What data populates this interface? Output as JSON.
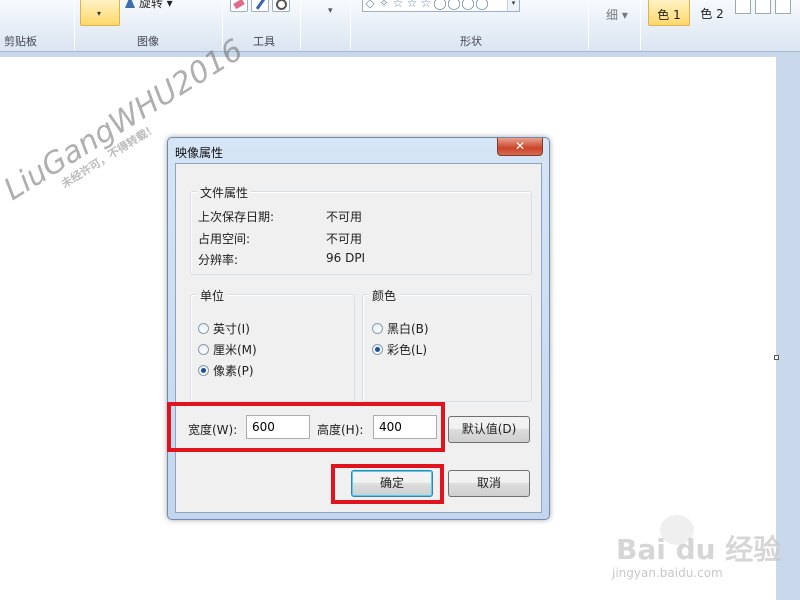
{
  "ribbon": {
    "groups": {
      "clipboard": "剪贴板",
      "image": "图像",
      "tools": "工具",
      "shapes": "形状"
    },
    "rotate_label": "旋转",
    "thin_label": "细",
    "color1": "色 1",
    "color2": "色 2",
    "shape_glyphs": [
      "◇",
      "✧",
      "☆",
      "☆",
      "☆",
      "◯",
      "◯",
      "◯",
      "◯"
    ]
  },
  "watermark": {
    "main": "LiuGangWHU2016",
    "sub": "未经许可，不得转载！"
  },
  "baidu": {
    "logo": "Bai du 经验",
    "url": "jingyan.baidu.com"
  },
  "dialog": {
    "title": "映像属性",
    "close_glyph": "✕",
    "file_props": {
      "title": "文件属性",
      "rows": [
        {
          "label": "上次保存日期:",
          "value": "不可用"
        },
        {
          "label": "占用空间:",
          "value": "不可用"
        },
        {
          "label": "分辨率:",
          "value": "96 DPI"
        }
      ]
    },
    "units": {
      "title": "单位",
      "options": [
        {
          "label": "英寸(I)",
          "selected": false
        },
        {
          "label": "厘米(M)",
          "selected": false
        },
        {
          "label": "像素(P)",
          "selected": true
        }
      ]
    },
    "color": {
      "title": "颜色",
      "options": [
        {
          "label": "黑白(B)",
          "selected": false
        },
        {
          "label": "彩色(L)",
          "selected": true
        }
      ]
    },
    "width_label": "宽度(W):",
    "width_value": "600",
    "height_label": "高度(H):",
    "height_value": "400",
    "default_button": "默认值(D)",
    "ok_button": "确定",
    "cancel_button": "取消"
  },
  "colors": {
    "highlight": "#e0141e",
    "ribbon_active": "#ffd86b"
  }
}
